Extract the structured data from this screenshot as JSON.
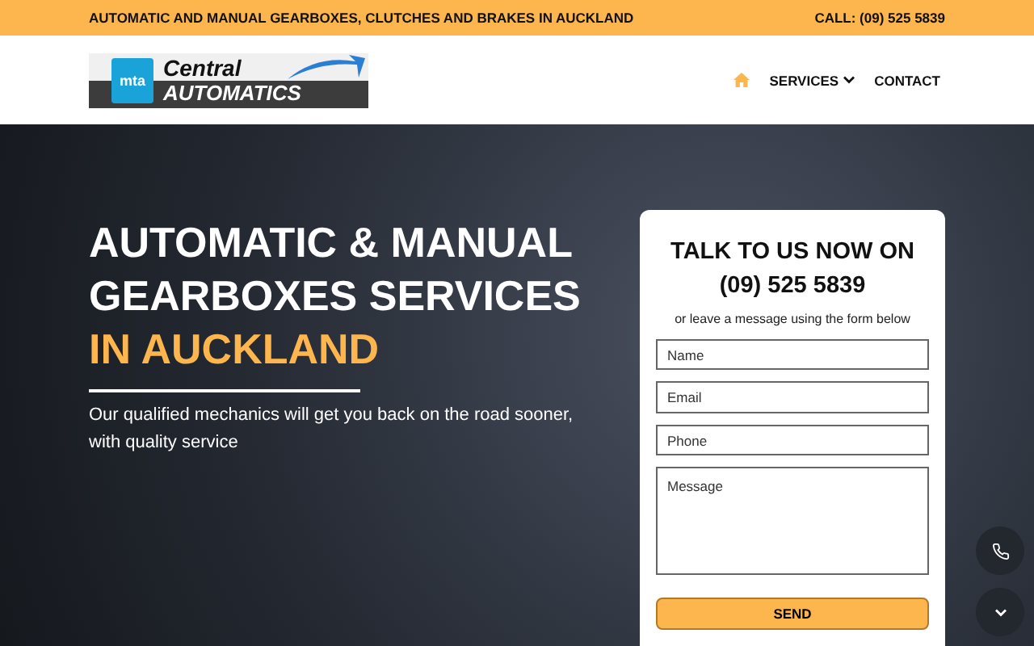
{
  "top_bar": {
    "tagline": "AUTOMATIC AND MANUAL GEARBOXES, CLUTCHES AND BRAKES IN AUCKLAND",
    "phone": "CALL: (09) 525 5839"
  },
  "header": {
    "logo": {
      "badge": "mta",
      "name_top": "Central",
      "name_bottom": "AUTOMATICS"
    },
    "nav": [
      {
        "kind": "home"
      },
      {
        "kind": "dropdown",
        "label": "SERVICES"
      },
      {
        "kind": "link",
        "label": "CONTACT"
      }
    ]
  },
  "hero": {
    "title_lines": [
      "AUTOMATIC & MANUAL",
      "GEARBOXES SERVICES"
    ],
    "title_accent": "IN AUCKLAND",
    "subtitle": "Our qualified mechanics will get you back on the road sooner, with quality service"
  },
  "form": {
    "title": "TALK TO US NOW ON",
    "phone": "(09) 525 5839",
    "note": "or leave a message using the form below",
    "fields": [
      {
        "kind": "input",
        "placeholder": "Name"
      },
      {
        "kind": "input",
        "placeholder": "Email"
      },
      {
        "kind": "input",
        "placeholder": "Phone"
      },
      {
        "kind": "textarea",
        "placeholder": "Message"
      }
    ],
    "submit": "SEND"
  }
}
